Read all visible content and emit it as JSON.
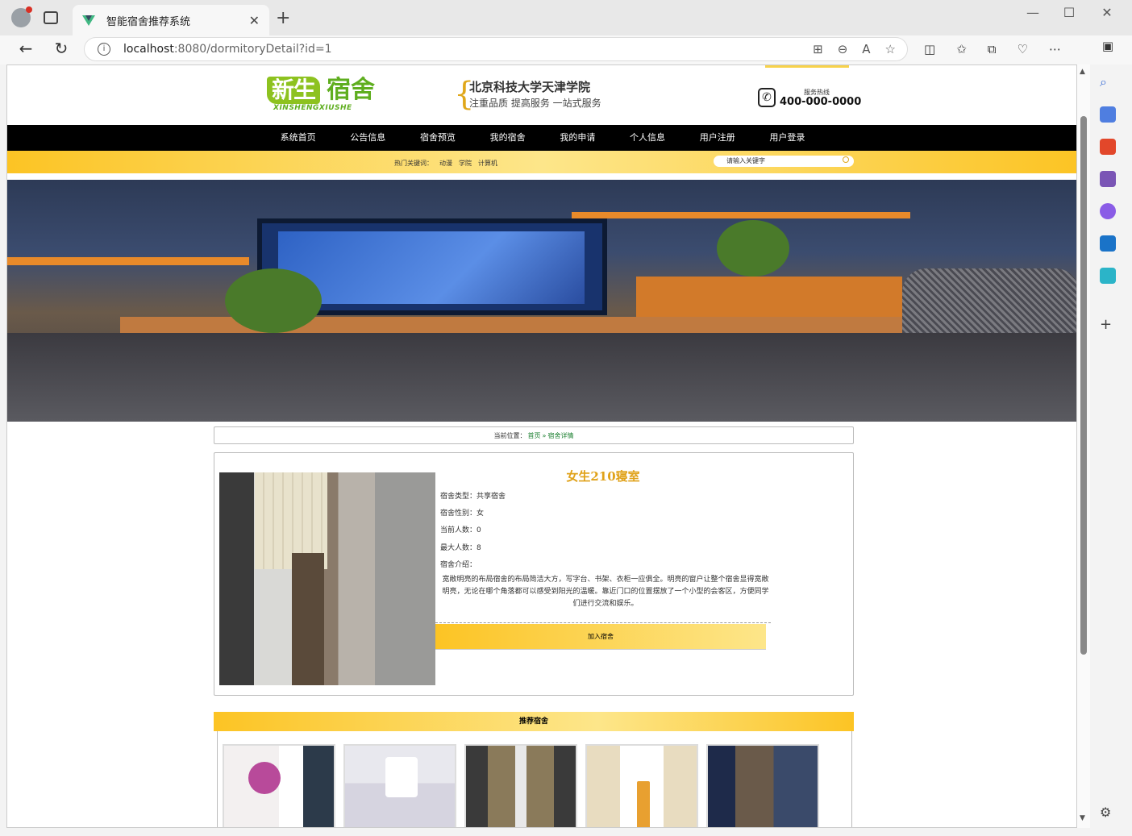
{
  "browser": {
    "tab_title": "智能宿舍推荐系统",
    "url_host": "localhost",
    "url_rest": ":8080/dormitoryDetail?id=1",
    "window_controls": [
      "—",
      "☐",
      "✕"
    ]
  },
  "header": {
    "logo_main": "新生",
    "logo_side": "宿舍",
    "logo_sub": "XINSHENGXIUSHE",
    "school_name": "北京科技大学天津学院",
    "school_slogan": "注重品质 提高服务 一站式服务",
    "hotline_label": "服务热线",
    "hotline_number": "400-000-0000"
  },
  "nav": {
    "items": [
      "系统首页",
      "公告信息",
      "宿舍预览",
      "我的宿舍",
      "我的申请",
      "个人信息",
      "用户注册",
      "用户登录"
    ]
  },
  "hot_search": {
    "label": "热门关键词：",
    "keywords": [
      "动漫",
      "学院",
      "计算机"
    ],
    "placeholder": "请输入关键字"
  },
  "breadcrumb": {
    "prefix": "当前位置：",
    "home": "首页",
    "sep": "»",
    "current": "宿舍详情"
  },
  "dormitory": {
    "name": "女生210寝室",
    "type_label": "宿舍类型：",
    "type_value": "共享宿舍",
    "gender_label": "宿舍性别：",
    "gender_value": "女",
    "current_label": "当前人数：",
    "current_value": "0",
    "max_label": "最大人数：",
    "max_value": "8",
    "intro_label": "宿舍介绍：",
    "intro_text": "宽敞明亮的布局宿舍的布局简洁大方，写字台、书架、衣柜一应俱全。明亮的窗户让整个宿舍显得宽敞明亮，无论在哪个角落都可以感受到阳光的温暖。靠近门口的位置摆放了一个小型的会客区，方便同学们进行交流和娱乐。",
    "join_button": "加入宿舍"
  },
  "recommend": {
    "title": "推荐宿舍"
  },
  "colors": {
    "nav_bg": "#000000",
    "accent_yellow": "#fcc424",
    "title_gold": "#e0a21a",
    "logo_green": "#8dc21f",
    "link_green": "#1a7f2f"
  }
}
